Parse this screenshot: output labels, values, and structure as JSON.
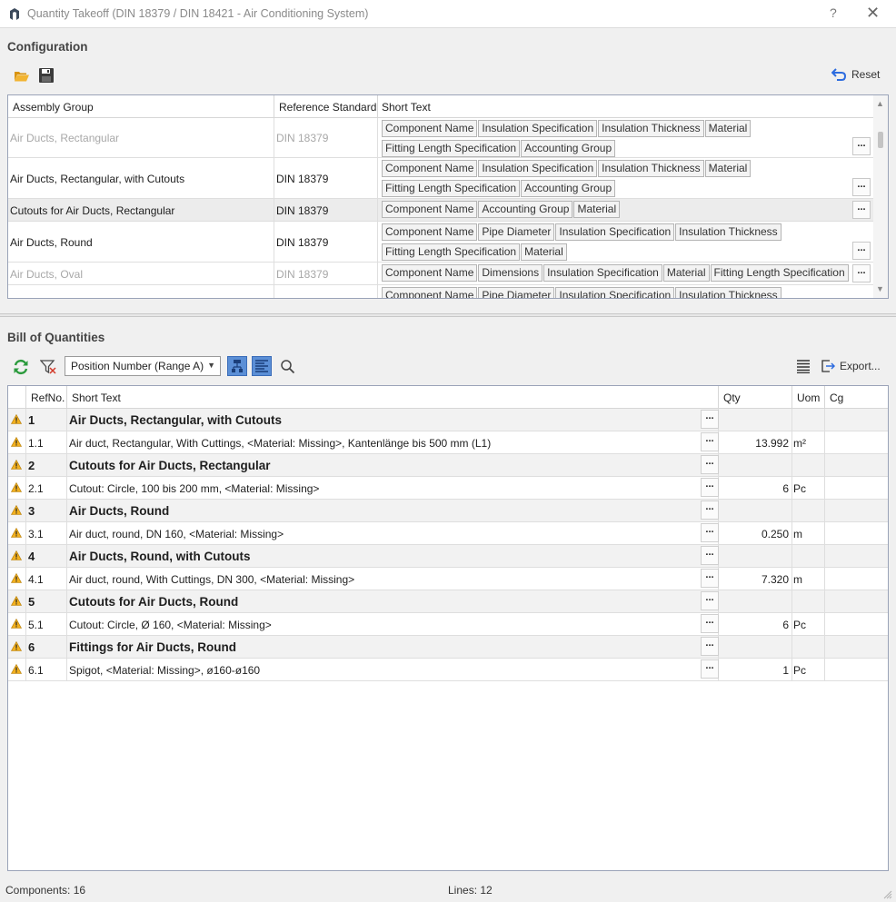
{
  "window": {
    "title": "Quantity Takeoff (DIN 18379 / DIN 18421 - Air Conditioning System)",
    "help": "?",
    "close": "✕"
  },
  "configuration": {
    "title": "Configuration",
    "reset_label": "Reset",
    "columns": [
      "Assembly Group",
      "Reference Standard",
      "Short Text"
    ],
    "rows": [
      {
        "group": "Air Ducts, Rectangular",
        "standard": "DIN 18379",
        "dim": true,
        "chips": [
          "Component Name",
          "Insulation Specification",
          "Insulation Thickness",
          "Material",
          "Fitting Length Specification",
          "Accounting Group"
        ]
      },
      {
        "group": "Air Ducts, Rectangular, with Cutouts",
        "standard": "DIN 18379",
        "dim": false,
        "chips": [
          "Component Name",
          "Insulation Specification",
          "Insulation Thickness",
          "Material",
          "Fitting Length Specification",
          "Accounting Group"
        ]
      },
      {
        "group": "Cutouts for Air Ducts, Rectangular",
        "standard": "DIN 18379",
        "dim": false,
        "selected": true,
        "chips": [
          "Component Name",
          "Accounting Group",
          "Material"
        ]
      },
      {
        "group": "Air Ducts, Round",
        "standard": "DIN 18379",
        "dim": false,
        "chips": [
          "Component Name",
          "Pipe Diameter",
          "Insulation Specification",
          "Insulation Thickness",
          "Fitting Length Specification",
          "Material"
        ]
      },
      {
        "group": "Air Ducts, Oval",
        "standard": "DIN 18379",
        "dim": true,
        "chips": [
          "Component Name",
          "Dimensions",
          "Insulation Specification",
          "Material",
          "Fitting Length Specification"
        ]
      },
      {
        "group": "",
        "standard": "",
        "dim": false,
        "chips": [
          "Component Name",
          "Pipe Diameter",
          "Insulation Specification",
          "Insulation Thickness"
        ]
      }
    ],
    "dots": "..."
  },
  "boq": {
    "title": "Bill of Quantities",
    "sort_selected": "Position Number (Range A)",
    "export_label": "Export...",
    "columns": {
      "ref": "RefNo.",
      "text": "Short Text",
      "qty": "Qty",
      "uom": "Uom",
      "cg": "Cg"
    },
    "rows": [
      {
        "ref": "1",
        "text": "Air Ducts, Rectangular, with Cutouts",
        "group": true,
        "qty": "",
        "uom": ""
      },
      {
        "ref": "1.1",
        "text": "Air duct, Rectangular, With Cuttings, <Material: Missing>, Kantenlänge bis 500 mm (L1)",
        "group": false,
        "qty": "13.992",
        "uom": "m²"
      },
      {
        "ref": "2",
        "text": "Cutouts for Air Ducts, Rectangular",
        "group": true,
        "qty": "",
        "uom": ""
      },
      {
        "ref": "2.1",
        "text": "Cutout: Circle, 100 bis 200 mm, <Material: Missing>",
        "group": false,
        "qty": "6",
        "uom": "Pc"
      },
      {
        "ref": "3",
        "text": "Air Ducts, Round",
        "group": true,
        "qty": "",
        "uom": ""
      },
      {
        "ref": "3.1",
        "text": "Air duct, round, DN 160, <Material: Missing>",
        "group": false,
        "qty": "0.250",
        "uom": "m"
      },
      {
        "ref": "4",
        "text": "Air Ducts, Round, with Cutouts",
        "group": true,
        "qty": "",
        "uom": ""
      },
      {
        "ref": "4.1",
        "text": "Air duct, round, With Cuttings, DN 300, <Material: Missing>",
        "group": false,
        "qty": "7.320",
        "uom": "m"
      },
      {
        "ref": "5",
        "text": "Cutouts for Air Ducts, Round",
        "group": true,
        "qty": "",
        "uom": ""
      },
      {
        "ref": "5.1",
        "text": "Cutout: Circle, Ø 160, <Material: Missing>",
        "group": false,
        "qty": "6",
        "uom": "Pc"
      },
      {
        "ref": "6",
        "text": "Fittings for Air Ducts, Round",
        "group": true,
        "qty": "",
        "uom": ""
      },
      {
        "ref": "6.1",
        "text": "Spigot, <Material: Missing>, ø160-ø160",
        "group": false,
        "qty": "1",
        "uom": "Pc"
      }
    ]
  },
  "status": {
    "components": "Components: 16",
    "lines": "Lines: 12"
  },
  "colors": {
    "accent": "#2d6cdf",
    "warning": "#f2b01e",
    "refresh": "#2a9a3c",
    "folder": "#e8a316"
  }
}
